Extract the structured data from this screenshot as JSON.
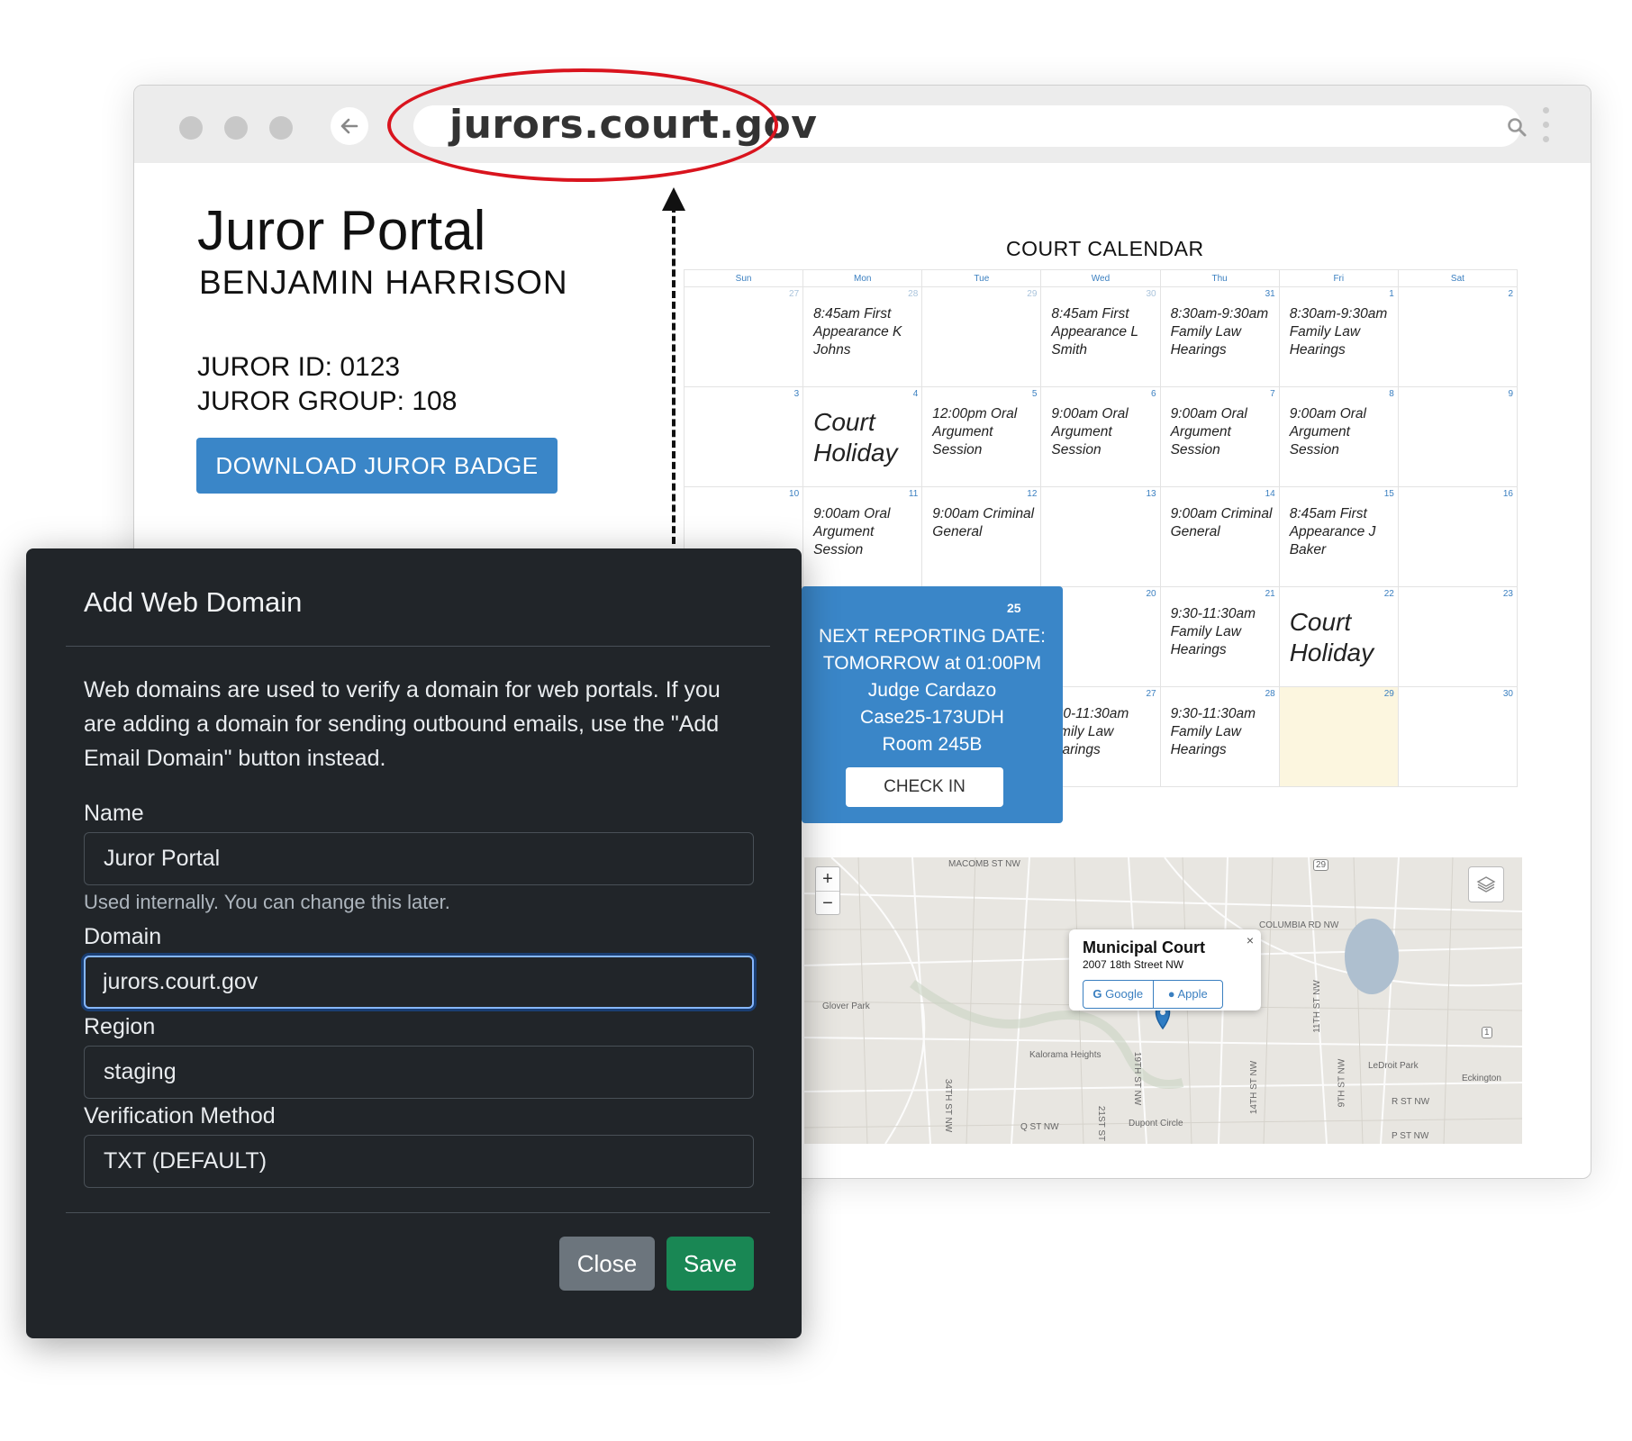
{
  "browser": {
    "url": "jurors.court.gov"
  },
  "portal": {
    "title": "Juror Portal",
    "juror_name": "BENJAMIN HARRISON",
    "juror_id": "JUROR ID: 0123",
    "juror_group": "JUROR GROUP: 108",
    "badge_button": "DOWNLOAD JUROR BADGE"
  },
  "calendar": {
    "title": "COURT CALENDAR",
    "weekdays": [
      "Sun",
      "Mon",
      "Tue",
      "Wed",
      "Thu",
      "Fri",
      "Sat"
    ],
    "weeks": [
      [
        {
          "day": "27",
          "event": ""
        },
        {
          "day": "28",
          "event": "8:45am First Appearance K Johns"
        },
        {
          "day": "29",
          "event": ""
        },
        {
          "day": "30",
          "event": "8:45am First Appearance L Smith"
        },
        {
          "day": "31",
          "event": "8:30am-9:30am Family Law Hearings"
        },
        {
          "day": "1",
          "event": "8:30am-9:30am Family Law Hearings"
        },
        {
          "day": "2",
          "event": ""
        }
      ],
      [
        {
          "day": "3",
          "event": ""
        },
        {
          "day": "4",
          "event": "Court Holiday"
        },
        {
          "day": "5",
          "event": "12:00pm Oral Argument Session"
        },
        {
          "day": "6",
          "event": "9:00am Oral Argument Session"
        },
        {
          "day": "7",
          "event": "9:00am Oral Argument Session"
        },
        {
          "day": "8",
          "event": "9:00am Oral Argument Session"
        },
        {
          "day": "9",
          "event": ""
        }
      ],
      [
        {
          "day": "10",
          "event": ""
        },
        {
          "day": "11",
          "event": "9:00am Oral Argument Session"
        },
        {
          "day": "12",
          "event": "9:00am Criminal General"
        },
        {
          "day": "13",
          "event": ""
        },
        {
          "day": "14",
          "event": "9:00am Criminal General"
        },
        {
          "day": "15",
          "event": "8:45am First Appearance J Baker"
        },
        {
          "day": "16",
          "event": ""
        }
      ],
      [
        {
          "day": "",
          "event": ""
        },
        {
          "day": "",
          "event": ""
        },
        {
          "day": "",
          "event": ""
        },
        {
          "day": "20",
          "event": ""
        },
        {
          "day": "21",
          "event": "9:30-11:30am Family Law Hearings"
        },
        {
          "day": "22",
          "event": "Court Holiday"
        },
        {
          "day": "23",
          "event": ""
        }
      ],
      [
        {
          "day": "",
          "event": ""
        },
        {
          "day": "",
          "event": ""
        },
        {
          "day": "",
          "event": ""
        },
        {
          "day": "27",
          "event": ":30-11:30am amily Law learings"
        },
        {
          "day": "28",
          "event": "9:30-11:30am Family Law Hearings"
        },
        {
          "day": "29",
          "event": ""
        },
        {
          "day": "30",
          "event": ""
        }
      ]
    ]
  },
  "reporting": {
    "day": "25",
    "label": "NEXT REPORTING DATE:",
    "when": "TOMORROW at 01:00PM",
    "judge": "Judge Cardazo",
    "case": "Case25-173UDH",
    "room": "Room 245B",
    "checkin_button": "CHECK IN"
  },
  "map": {
    "zoom_in": "+",
    "zoom_out": "−",
    "place_name": "Municipal Court",
    "place_address": "2007 18th Street NW",
    "google_button": "Google",
    "apple_button": "Apple",
    "close": "×",
    "labels": {
      "macomb": "MACOMB ST NW",
      "columbia": "COLUMBIA RD NW",
      "glover": "Glover Park",
      "kalorama": "Kalorama Heights",
      "ledroit": "LeDroit Park",
      "eckington": "Eckington",
      "q_st": "Q ST NW",
      "r_st": "R ST NW",
      "p_st": "P ST NW",
      "dupont": "Dupont Circle",
      "th34": "34TH ST NW",
      "th19": "19TH ST NW",
      "th21": "21ST ST",
      "th11": "11TH ST NW",
      "th14": "14TH ST NW",
      "th9": "9TH ST NW",
      "r29": "29",
      "r1": "1"
    }
  },
  "modal": {
    "title": "Add Web Domain",
    "description": "Web domains are used to verify a domain for web portals. If you are adding a domain for sending outbound emails, use the \"Add Email Domain\" button instead.",
    "name_label": "Name",
    "name_value": "Juror Portal",
    "name_help": "Used internally. You can change this later.",
    "domain_label": "Domain",
    "domain_value": "jurors.court.gov",
    "region_label": "Region",
    "region_value": "staging",
    "verification_label": "Verification Method",
    "verification_value": "TXT (DEFAULT)",
    "close_button": "Close",
    "save_button": "Save"
  },
  "colors": {
    "accent_blue": "#3a86c8",
    "highlight_red": "#d9141e",
    "modal_bg": "#212529",
    "save_green": "#198754",
    "close_gray": "#6c757d",
    "today_bg": "#fcf6df"
  }
}
